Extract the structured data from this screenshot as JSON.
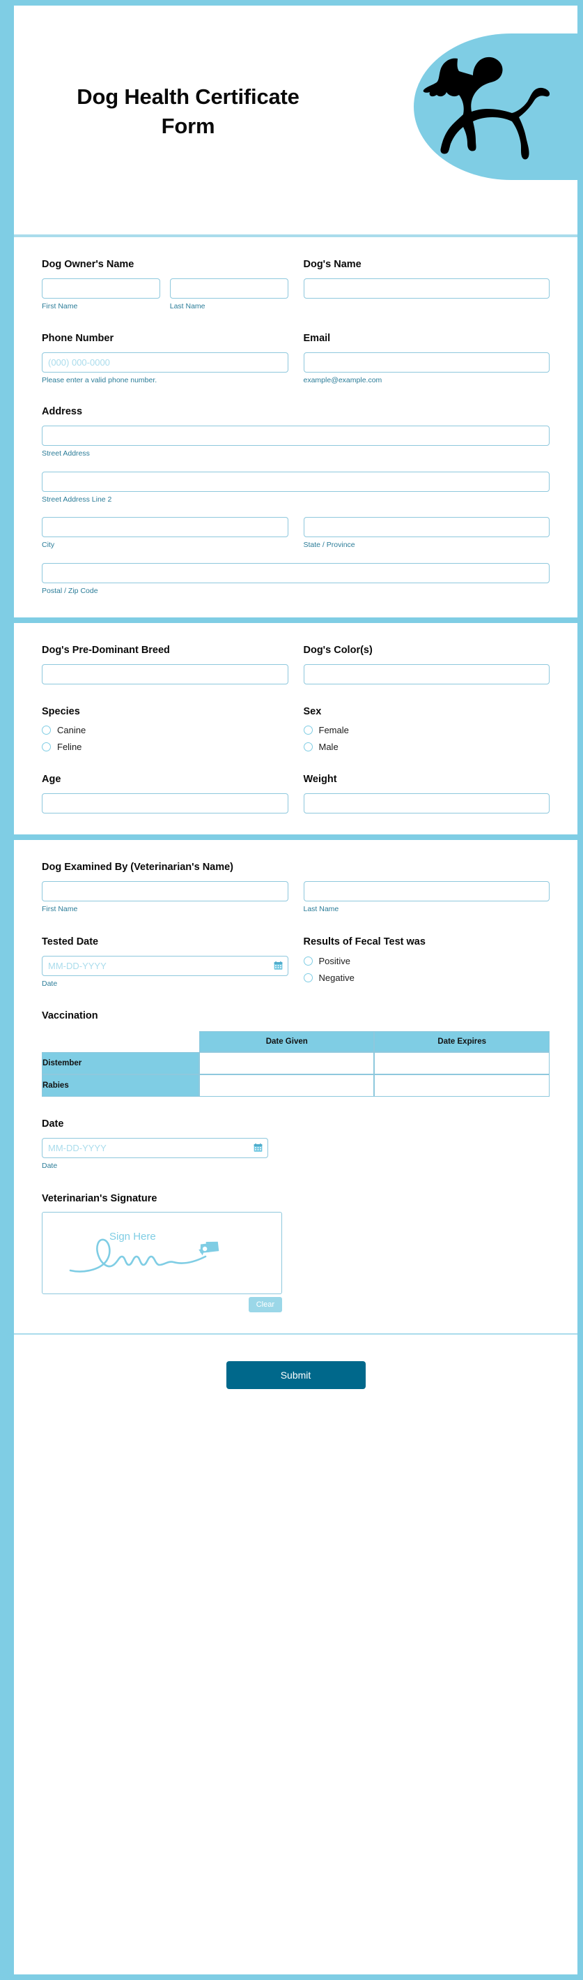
{
  "header": {
    "title_line1": "Dog Health Certificate",
    "title_line2": "Form",
    "dog_icon": "dog-silhouette-icon"
  },
  "theme": {
    "brand_blue": "#7FCDE4",
    "border_blue": "#8ec8dd",
    "sublabel_blue": "#2b7c98",
    "submit_teal": "#00688B",
    "clear_blue": "#9bd7e8"
  },
  "section_owner": {
    "owner_name": {
      "label": "Dog Owner's Name",
      "first_value": "",
      "first_sublabel": "First Name",
      "last_value": "",
      "last_sublabel": "Last Name"
    },
    "dog_name": {
      "label": "Dog's Name",
      "value": ""
    },
    "phone": {
      "label": "Phone Number",
      "value": "",
      "placeholder": "(000) 000-0000",
      "hint": "Please enter a valid phone number."
    },
    "email": {
      "label": "Email",
      "value": "",
      "hint": "example@example.com"
    },
    "address": {
      "label": "Address",
      "street_value": "",
      "street_sublabel": "Street Address",
      "street2_value": "",
      "street2_sublabel": "Street Address Line 2",
      "city_value": "",
      "city_sublabel": "City",
      "state_value": "",
      "state_sublabel": "State / Province",
      "postal_value": "",
      "postal_sublabel": "Postal / Zip Code"
    }
  },
  "section_dog": {
    "breed": {
      "label": "Dog's Pre-Dominant Breed",
      "value": ""
    },
    "color": {
      "label": "Dog's Color(s)",
      "value": ""
    },
    "species": {
      "label": "Species",
      "options": [
        "Canine",
        "Feline"
      ],
      "selected": ""
    },
    "sex": {
      "label": "Sex",
      "options": [
        "Female",
        "Male"
      ],
      "selected": ""
    },
    "age": {
      "label": "Age",
      "value": ""
    },
    "weight": {
      "label": "Weight",
      "value": ""
    }
  },
  "section_vet": {
    "vet_name": {
      "label": "Dog Examined By (Veterinarian's Name)",
      "first_value": "",
      "first_sublabel": "First Name",
      "last_value": "",
      "last_sublabel": "Last Name"
    },
    "tested_date": {
      "label": "Tested Date",
      "value": "",
      "placeholder": "MM-DD-YYYY",
      "sublabel": "Date",
      "icon": "calendar-icon"
    },
    "fecal": {
      "label": "Results of Fecal Test was",
      "options": [
        "Positive",
        "Negative"
      ],
      "selected": ""
    },
    "vaccination": {
      "label": "Vaccination",
      "columns": [
        "",
        "Date Given",
        "Date Expires"
      ],
      "rows": [
        {
          "name": "Distember",
          "date_given": "",
          "date_expires": ""
        },
        {
          "name": "Rabies",
          "date_given": "",
          "date_expires": ""
        }
      ]
    },
    "date": {
      "label": "Date",
      "value": "",
      "placeholder": "MM-DD-YYYY",
      "sublabel": "Date",
      "icon": "calendar-icon"
    },
    "signature": {
      "label": "Veterinarian's Signature",
      "placeholder_text": "Sign Here",
      "clear_label": "Clear",
      "icon": "pen-nib-icon"
    }
  },
  "footer": {
    "submit_label": "Submit"
  }
}
